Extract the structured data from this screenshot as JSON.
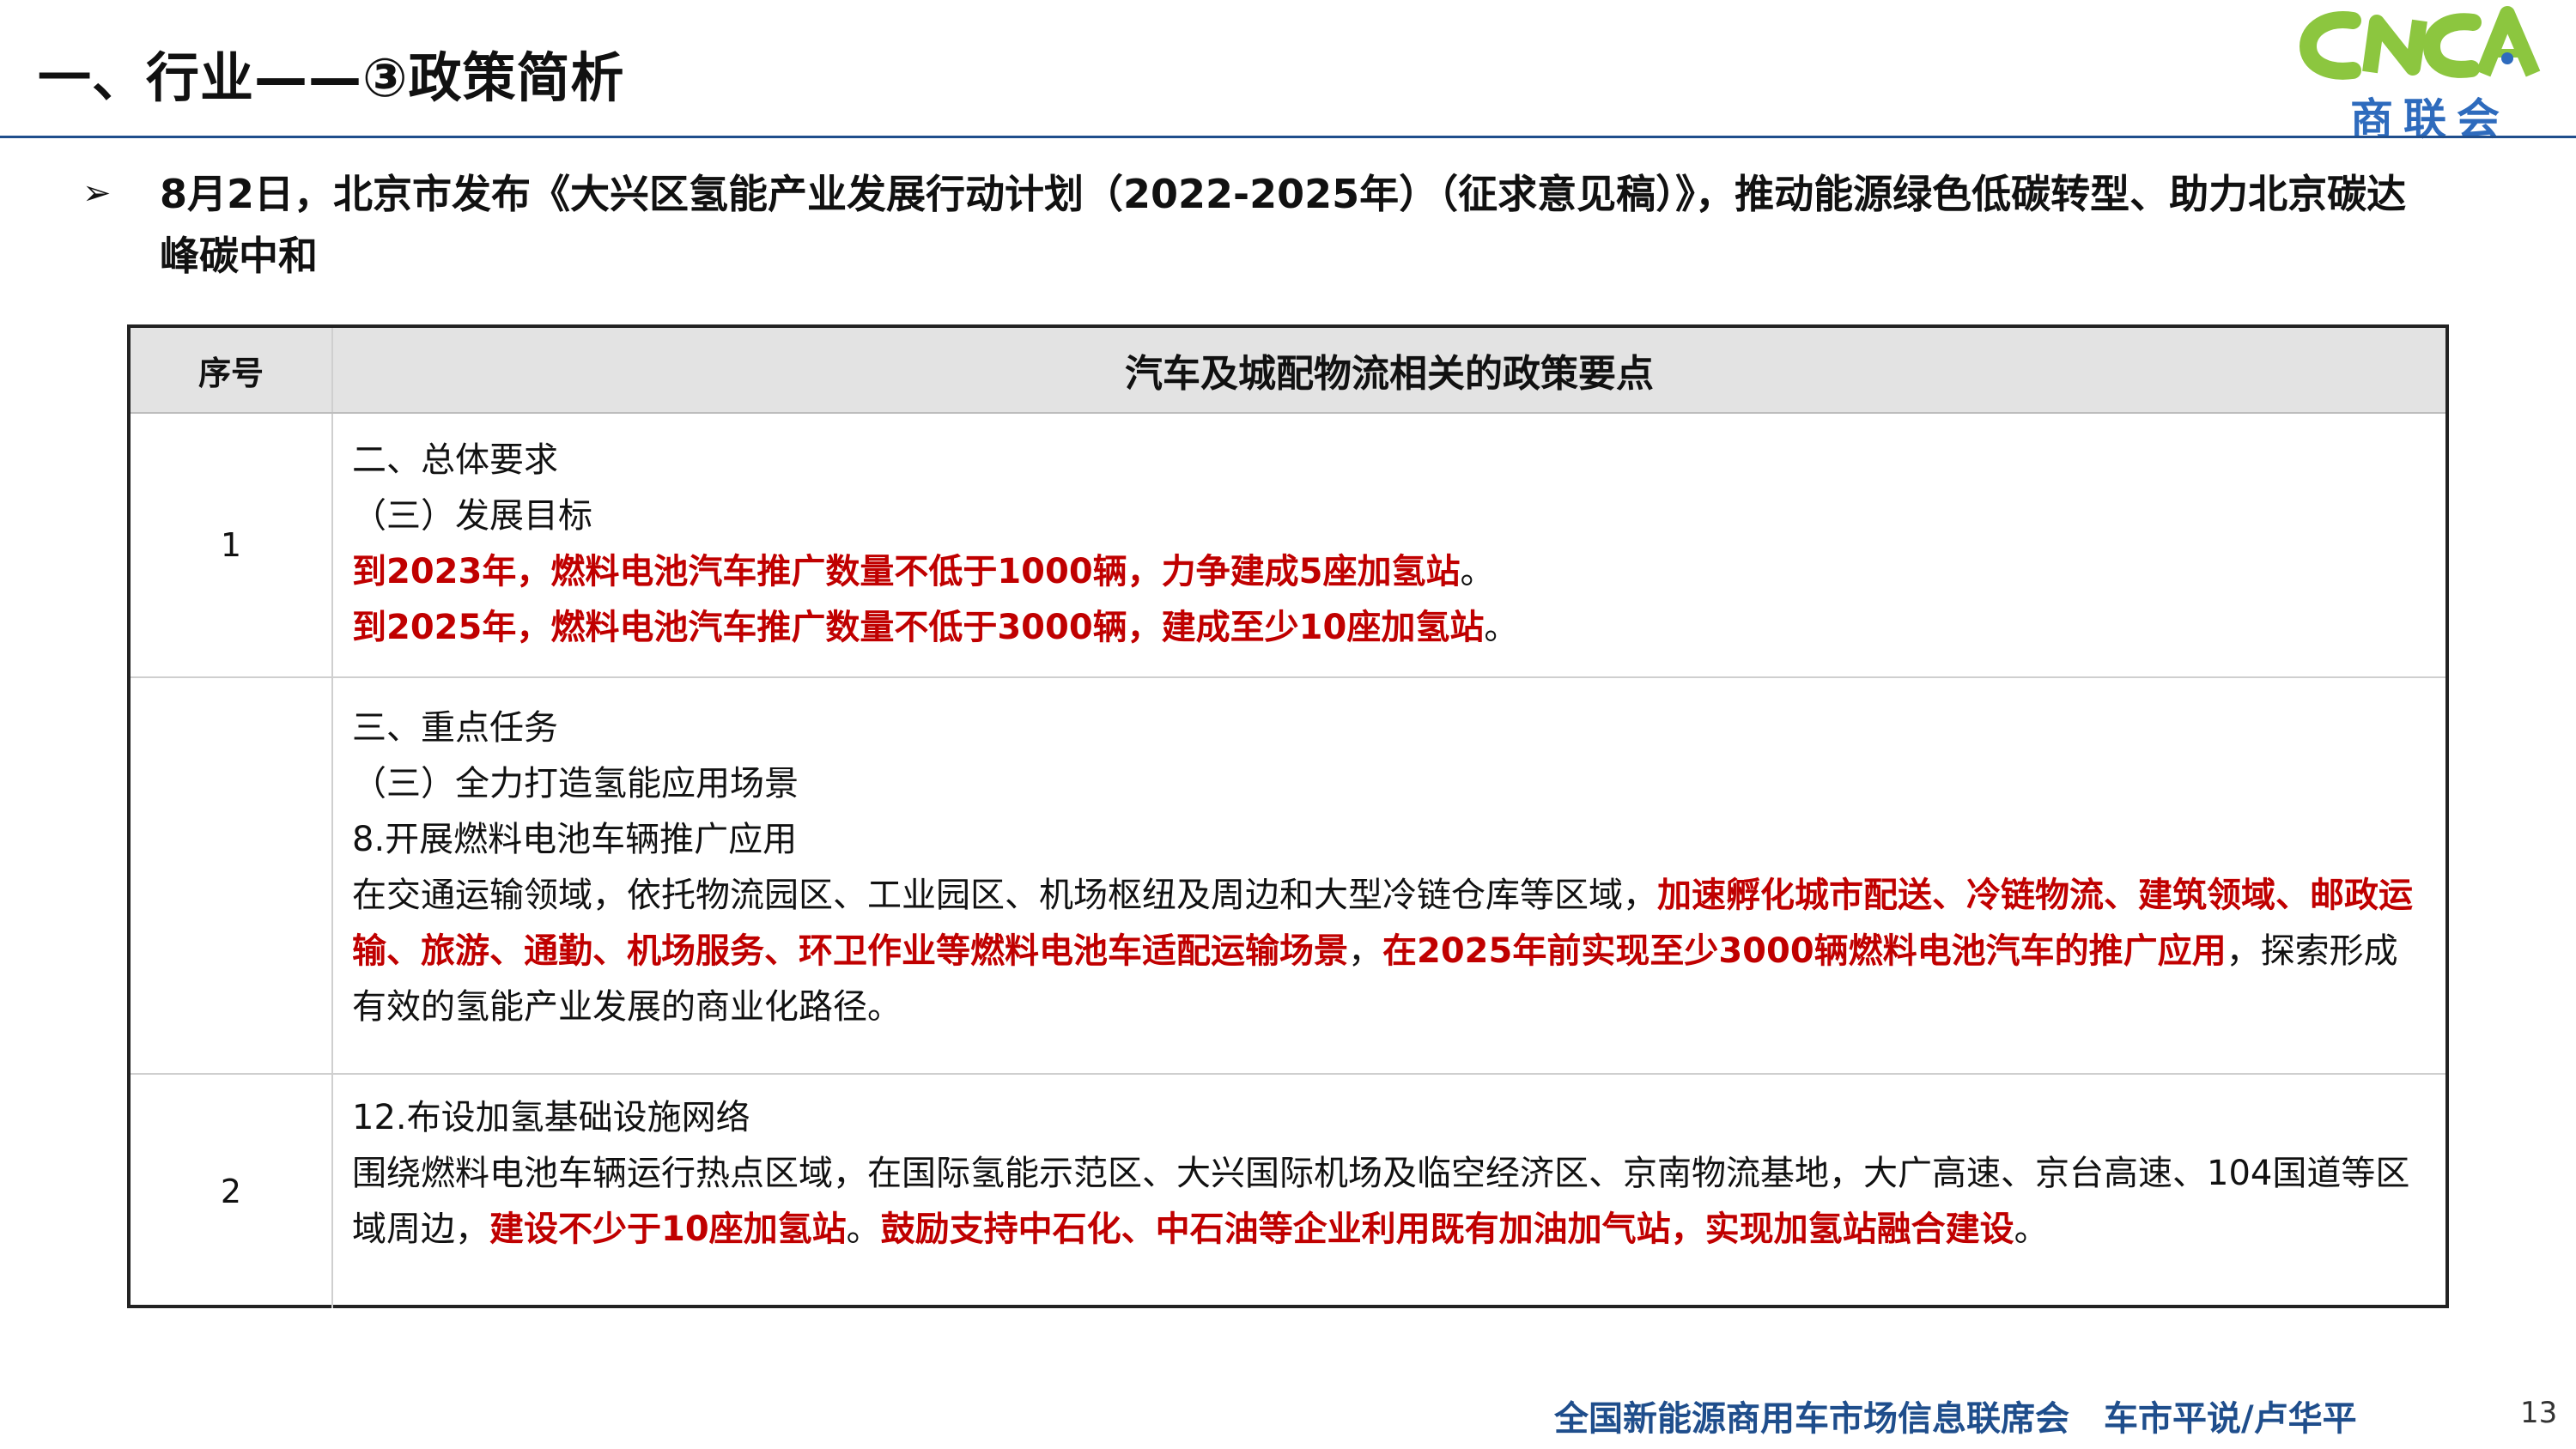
{
  "title": "一、行业——③政策简析",
  "logo": {
    "letters": "CNCA",
    "chinese": "商联会"
  },
  "headline": "8月2日，北京市发布《大兴区氢能产业发展行动计划（2022-2025年）（征求意见稿）》，推动能源绿色低碳转型、助力北京碳达峰碳中和",
  "table": {
    "headers": {
      "no": "序号",
      "content": "汽车及城配物流相关的政策要点"
    },
    "row1": {
      "no": "1",
      "line1": "二、总体要求",
      "line2": "（三）发展目标",
      "line3": "到2023年，燃料电池汽车推广数量不低于1000辆，力争建成5座加氢站",
      "line3_end": "。",
      "line4": "到2025年，燃料电池汽车推广数量不低于3000辆，建成至少10座加氢站",
      "line4_end": "。"
    },
    "row2": {
      "no": "",
      "line1": "三、重点任务",
      "line2": "（三）全力打造氢能应用场景",
      "line3": "8.开展燃料电池车辆推广应用",
      "para_a": "在交通运输领域，依托物流园区、工业园区、机场枢纽及周边和大型冷链仓库等区域，",
      "para_b": "加速孵化城市配送、冷链物流、建筑领域、邮政运输、旅游、通勤、机场服务、环卫作业等燃料电池车适配运输场景",
      "para_c": "，",
      "para_d": "在2025年前实现至少3000辆燃料电池汽车的推广应用",
      "para_e": "，探索形成有效的氢能产业发展的商业化路径。"
    },
    "row3": {
      "no": "2",
      "line1": "12.布设加氢基础设施网络",
      "para_a": "围绕燃料电池车辆运行热点区域，在国际氢能示范区、大兴国际机场及临空经济区、京南物流基地，大广高速、京台高速、104国道等区域周边，",
      "para_b": "建设不少于10座加氢站",
      "para_c": "。",
      "para_d": "鼓励支持中石化、中石油等企业利用既有加油加气站，实现加氢站融合建设",
      "para_e": "。"
    }
  },
  "footer": "全国新能源商用车市场信息联席会　车市平说/卢华平",
  "page_number": "13",
  "colors": {
    "accent_red": "#c00000",
    "brand_blue": "#1f4e8c",
    "logo_green": "#8cc63f"
  }
}
